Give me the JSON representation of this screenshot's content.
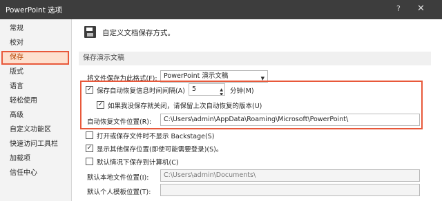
{
  "window": {
    "title": "PowerPoint 选项",
    "help_glyph": "?",
    "close_glyph": "✕"
  },
  "sidebar": {
    "items": [
      {
        "label": "常规"
      },
      {
        "label": "校对"
      },
      {
        "label": "保存",
        "active": true
      },
      {
        "label": "版式"
      },
      {
        "label": "语言"
      },
      {
        "label": "轻松使用"
      },
      {
        "label": "高级"
      },
      {
        "label": "自定义功能区"
      },
      {
        "label": "快速访问工具栏"
      },
      {
        "label": "加载项"
      },
      {
        "label": "信任中心"
      }
    ]
  },
  "header": {
    "icon": "save-icon",
    "title": "自定义文档保存方式。"
  },
  "section": {
    "title": "保存演示文稿"
  },
  "save_format": {
    "label": "将文件保存为此格式(F):",
    "value": "PowerPoint 演示文稿"
  },
  "autorecover": {
    "checked": true,
    "label": "保存自动恢复信息时间间隔(A)",
    "minutes": "5",
    "unit": "分钟(M)"
  },
  "keep_last": {
    "checked": true,
    "label": "如果我没保存就关闭，请保留上次自动恢复的版本(U)"
  },
  "autorecover_location": {
    "label": "自动恢复文件位置(R):",
    "value": "C:\\Users\\admin\\AppData\\Roaming\\Microsoft\\PowerPoint\\"
  },
  "no_backstage": {
    "checked": false,
    "label": "打开或保存文件时不显示 Backstage(S)"
  },
  "show_more_locations": {
    "checked": true,
    "label": "显示其他保存位置(即使可能需要登录)(S)。"
  },
  "default_computer": {
    "checked": false,
    "label": "默认情况下保存到计算机(C)"
  },
  "default_local": {
    "label": "默认本地文件位置(I):",
    "value": "C:\\Users\\admin\\Documents\\"
  },
  "default_templates": {
    "label": "默认个人模板位置(T):",
    "value": ""
  },
  "colors": {
    "highlight": "#e8583a",
    "titlebar": "#3d3d3d"
  }
}
